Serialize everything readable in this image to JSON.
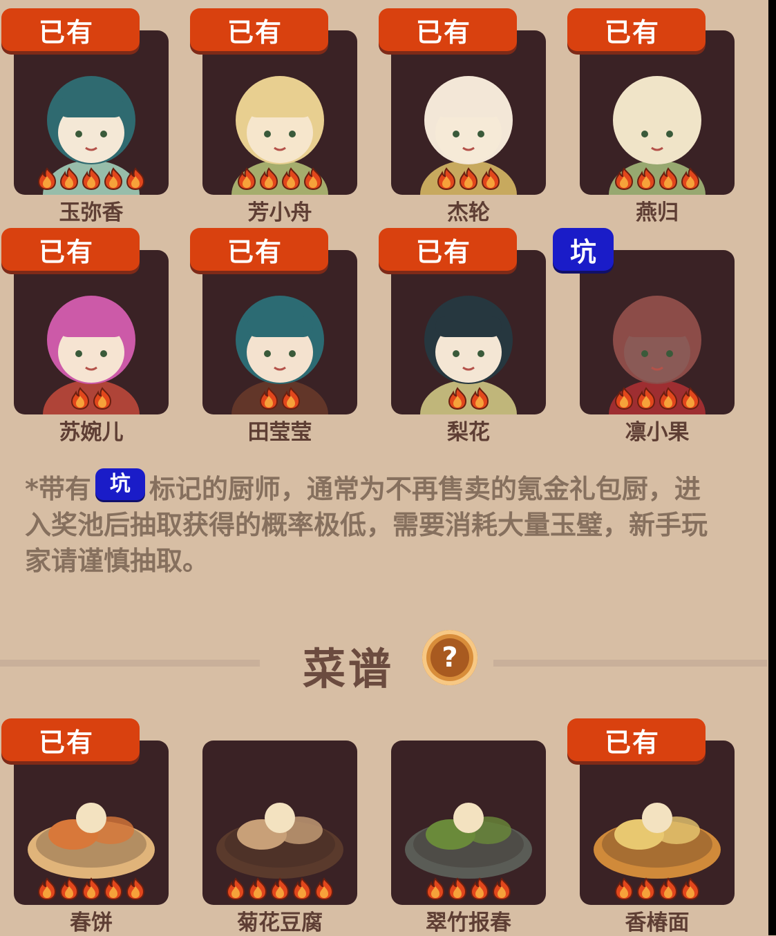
{
  "badges": {
    "owned": "已有",
    "pit": "坑"
  },
  "chefs": [
    {
      "name": "玉弥香",
      "owned": true,
      "pit": false,
      "stars": 5,
      "hair": "#2f6a70",
      "skin": "#f4e8d6",
      "accent": "#a8d8c2"
    },
    {
      "name": "芳小舟",
      "owned": true,
      "pit": false,
      "stars": 4,
      "hair": "#e8cf90",
      "skin": "#f6e6cc",
      "accent": "#b8c67a"
    },
    {
      "name": "杰轮",
      "owned": true,
      "pit": false,
      "stars": 3,
      "hair": "#f3e7d7",
      "skin": "#f6ead7",
      "accent": "#e1c168"
    },
    {
      "name": "燕归",
      "owned": true,
      "pit": false,
      "stars": 4,
      "hair": "#f0e4c8",
      "skin": "#f0e4c8",
      "accent": "#a8c07e"
    },
    {
      "name": "苏婉儿",
      "owned": true,
      "pit": false,
      "stars": 2,
      "hair": "#cc5aa8",
      "skin": "#f6e4d2",
      "accent": "#c44a3c"
    },
    {
      "name": "田莹莹",
      "owned": true,
      "pit": false,
      "stars": 2,
      "hair": "#2c6b73",
      "skin": "#f4e2cf",
      "accent": "#6a3a2a"
    },
    {
      "name": "梨花",
      "owned": true,
      "pit": false,
      "stars": 2,
      "hair": "#26373f",
      "skin": "#f4e6d4",
      "accent": "#d8d08a"
    },
    {
      "name": "凛小果",
      "owned": false,
      "pit": true,
      "stars": 4,
      "hair": "#8c4c48",
      "skin": "#8a5a56",
      "accent": "#b03034"
    }
  ],
  "note": {
    "prefix": "*带有",
    "suffix": "标记的厨师，通常为不再售卖的氪金礼包厨，进入奖池后抽取获得的概率极低，需要消耗大量玉璧，新手玩家请谨慎抽取。"
  },
  "recipes_section": {
    "title": "菜谱",
    "help_icon": "?"
  },
  "recipes": [
    {
      "name": "春饼",
      "owned": true,
      "stars": 5,
      "plate": "#e0b47a",
      "food": "#d8783a"
    },
    {
      "name": "菊花豆腐",
      "owned": false,
      "stars": 5,
      "plate": "#5a3a2c",
      "food": "#c8a078"
    },
    {
      "name": "翠竹报春",
      "owned": false,
      "stars": 4,
      "plate": "#5a5c56",
      "food": "#6a8a3a"
    },
    {
      "name": "香椿面",
      "owned": true,
      "stars": 4,
      "plate": "#d08a3a",
      "food": "#e8c870"
    }
  ],
  "colors": {
    "background": "#d7bea4",
    "owned_badge": "#d9410f",
    "pit_badge": "#1a1cc8",
    "tile": "#3a2225",
    "name_text": "#5e3e34"
  }
}
